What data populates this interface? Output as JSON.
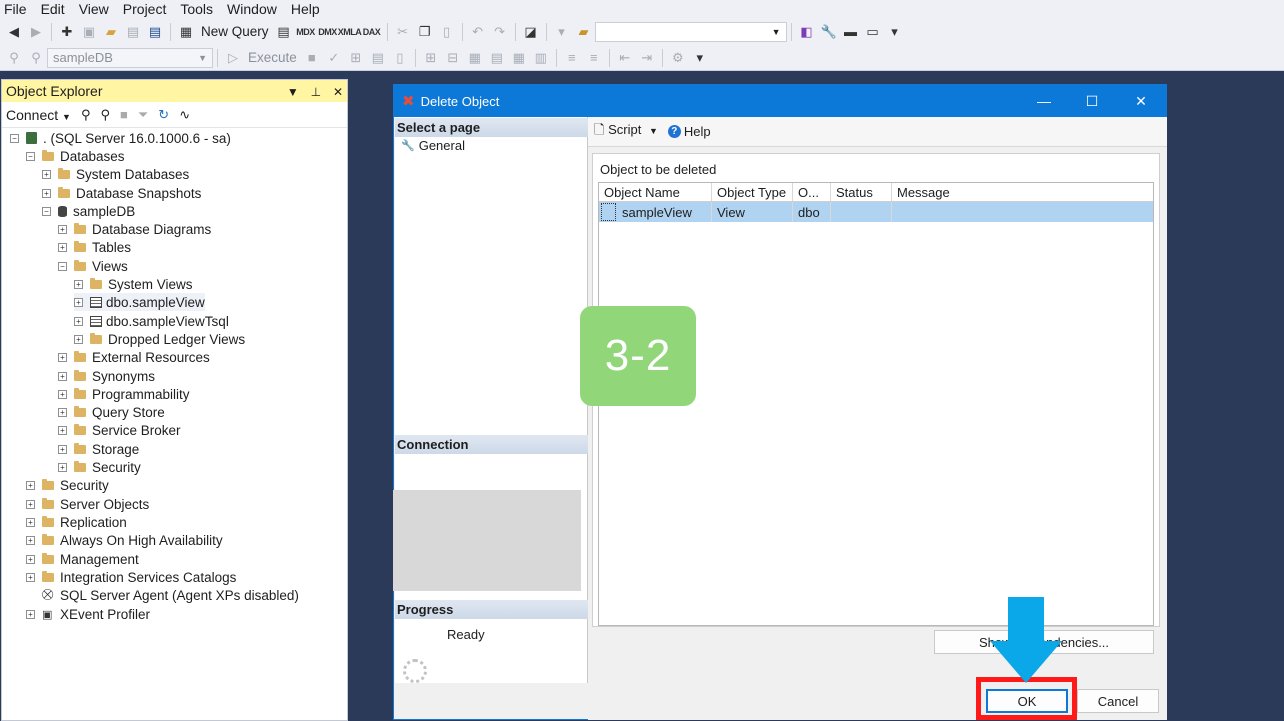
{
  "menu": [
    "File",
    "Edit",
    "View",
    "Project",
    "Tools",
    "Window",
    "Help"
  ],
  "toolbar": {
    "new_query": "New Query",
    "execute": "Execute",
    "database": "sampleDB",
    "mdx": "MDX",
    "dmx": "DMX",
    "xmla": "XMLA",
    "dax": "DAX"
  },
  "object_explorer": {
    "title": "Object Explorer",
    "connect": "Connect",
    "nodes": [
      {
        "label": ". (SQL Server 16.0.1000.6 - sa)"
      },
      {
        "label": "Databases"
      },
      {
        "label": "System Databases"
      },
      {
        "label": "Database Snapshots"
      },
      {
        "label": "sampleDB"
      },
      {
        "label": "Database Diagrams"
      },
      {
        "label": "Tables"
      },
      {
        "label": "Views"
      },
      {
        "label": "System Views"
      },
      {
        "label": "dbo.sampleView"
      },
      {
        "label": "dbo.sampleViewTsql"
      },
      {
        "label": "Dropped Ledger Views"
      },
      {
        "label": "External Resources"
      },
      {
        "label": "Synonyms"
      },
      {
        "label": "Programmability"
      },
      {
        "label": "Query Store"
      },
      {
        "label": "Service Broker"
      },
      {
        "label": "Storage"
      },
      {
        "label": "Security"
      },
      {
        "label": "Security"
      },
      {
        "label": "Server Objects"
      },
      {
        "label": "Replication"
      },
      {
        "label": "Always On High Availability"
      },
      {
        "label": "Management"
      },
      {
        "label": "Integration Services Catalogs"
      },
      {
        "label": "SQL Server Agent (Agent XPs disabled)"
      },
      {
        "label": "XEvent Profiler"
      }
    ]
  },
  "dialog": {
    "title": "Delete Object",
    "select_page": "Select a page",
    "general": "General",
    "connection": "Connection",
    "progress": "Progress",
    "progress_status": "Ready",
    "script": "Script",
    "help": "Help",
    "object_to_delete": "Object to be deleted",
    "columns": [
      "Object Name",
      "Object Type",
      "O...",
      "Status",
      "Message"
    ],
    "rows": [
      {
        "name": "sampleView",
        "type": "View",
        "owner": "dbo",
        "status": "",
        "message": ""
      }
    ],
    "show_dependencies": "Show Dependencies...",
    "ok": "OK",
    "cancel": "Cancel"
  },
  "annotation": {
    "step": "3-2",
    "step_color": "#91d77a",
    "highlight_color": "#ff1919",
    "arrow_color": "#0aa8e8"
  }
}
